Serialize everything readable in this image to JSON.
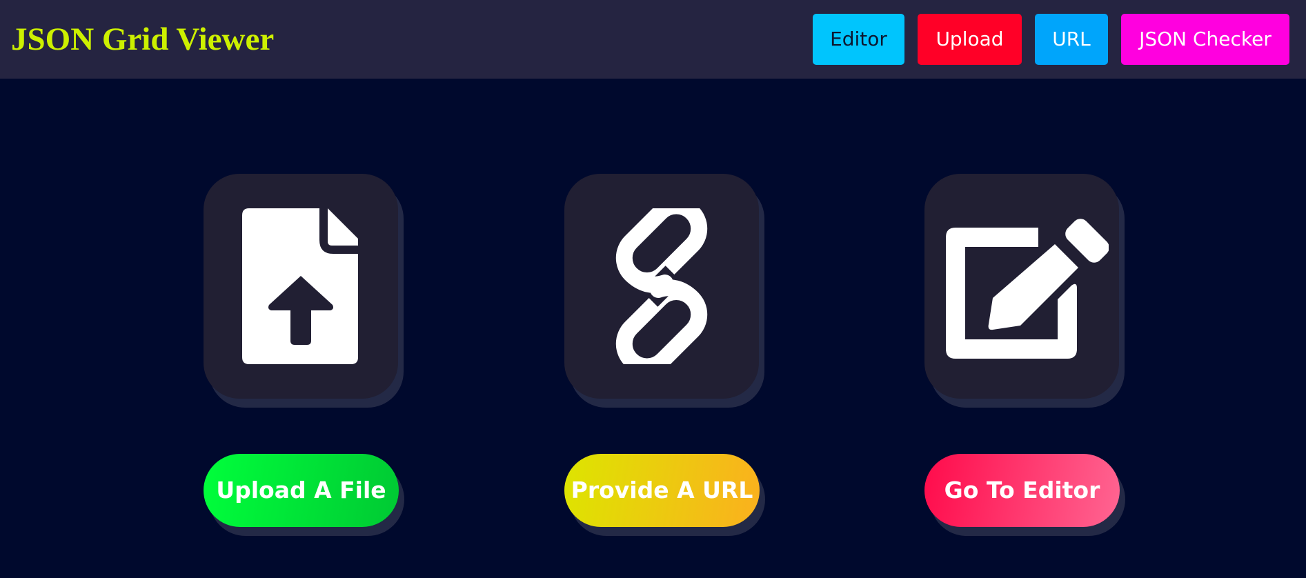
{
  "header": {
    "title": "JSON Grid Viewer",
    "nav": {
      "editor": "Editor",
      "upload": "Upload",
      "url": "URL",
      "json_checker": "JSON Checker"
    }
  },
  "actions": {
    "upload": {
      "icon": "file-upload-icon",
      "label": "Upload A File"
    },
    "url": {
      "icon": "link-icon",
      "label": "Provide A URL"
    },
    "editor": {
      "icon": "edit-icon",
      "label": "Go To Editor"
    }
  },
  "colors": {
    "background": "#00092d",
    "header_bg": "#252441",
    "title": "#cdf000",
    "nav_editor": "#00c5fd",
    "nav_upload": "#ff0027",
    "nav_url": "#00a5fb",
    "nav_json_checker": "#ff00df",
    "tile": "#211f33",
    "upload_gradient": [
      "#00ff3b",
      "#00c933"
    ],
    "url_gradient": [
      "#dde500",
      "#fbb01e"
    ],
    "editor_gradient": [
      "#ff0b4b",
      "#ff6592"
    ]
  }
}
